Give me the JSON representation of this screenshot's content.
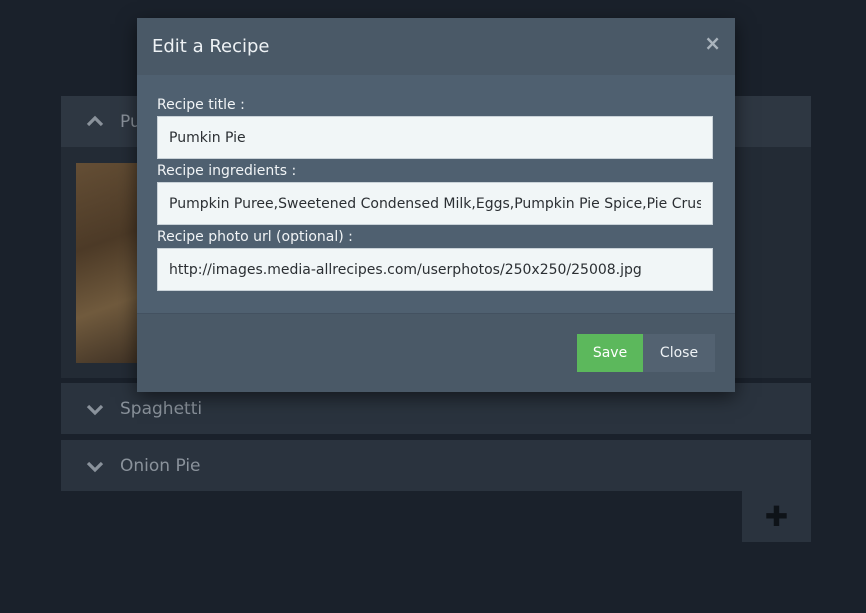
{
  "recipes": [
    {
      "title": "Pu",
      "expanded": true
    },
    {
      "title": "Spaghetti",
      "expanded": false
    },
    {
      "title": "Onion Pie",
      "expanded": false
    }
  ],
  "add_button": {
    "label": "✚",
    "icon": "plus-icon"
  },
  "modal": {
    "title": "Edit a Recipe",
    "close_glyph": "×",
    "fields": {
      "title_label": "Recipe title :",
      "title_value": "Pumkin Pie",
      "ingredients_label": "Recipe ingredients :",
      "ingredients_value": "Pumpkin Puree,Sweetened Condensed Milk,Eggs,Pumpkin Pie Spice,Pie Crust",
      "photo_label": "Recipe photo url (optional) :",
      "photo_value": "http://images.media-allrecipes.com/userphotos/250x250/25008.jpg"
    },
    "save_label": "Save",
    "close_label": "Close"
  },
  "colors": {
    "save": "#5cb85c",
    "background": "#1a212b",
    "modal": "#4a5967"
  }
}
